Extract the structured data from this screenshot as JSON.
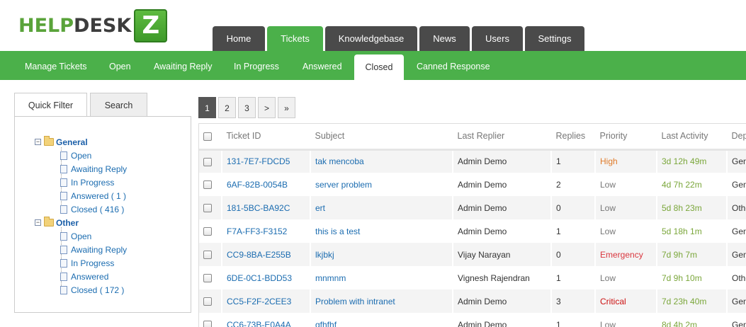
{
  "logo": {
    "part1": "HELP",
    "part2": "DESK",
    "badge": "Z"
  },
  "main_nav": [
    {
      "label": "Home"
    },
    {
      "label": "Tickets"
    },
    {
      "label": "Knowledgebase"
    },
    {
      "label": "News"
    },
    {
      "label": "Users"
    },
    {
      "label": "Settings"
    }
  ],
  "main_nav_active": "Tickets",
  "sub_nav": [
    {
      "label": "Manage Tickets"
    },
    {
      "label": "Open"
    },
    {
      "label": "Awaiting Reply"
    },
    {
      "label": "In Progress"
    },
    {
      "label": "Answered"
    },
    {
      "label": "Closed"
    },
    {
      "label": "Canned Response"
    }
  ],
  "sub_nav_active": "Closed",
  "filter_tabs": [
    {
      "label": "Quick Filter"
    },
    {
      "label": "Search"
    }
  ],
  "tree": {
    "groups": [
      {
        "label": "General",
        "items": [
          {
            "label": "Open"
          },
          {
            "label": "Awaiting Reply"
          },
          {
            "label": "In Progress"
          },
          {
            "label": "Answered ( 1 )"
          },
          {
            "label": "Closed ( 416 )"
          }
        ]
      },
      {
        "label": "Other",
        "items": [
          {
            "label": "Open"
          },
          {
            "label": "Awaiting Reply"
          },
          {
            "label": "In Progress"
          },
          {
            "label": "Answered"
          },
          {
            "label": "Closed ( 172 )"
          }
        ]
      }
    ]
  },
  "pagination": [
    "1",
    "2",
    "3",
    ">",
    "»"
  ],
  "pagination_active": "1",
  "table": {
    "columns": [
      "Ticket ID",
      "Subject",
      "Last Replier",
      "Replies",
      "Priority",
      "Last Activity",
      "Department"
    ],
    "rows": [
      {
        "id": "131-7E7-FDCD5",
        "subject": "tak mencoba",
        "replier": "Admin Demo",
        "replies": "1",
        "priority": "High",
        "activity": "3d 12h 49m",
        "dept": "General"
      },
      {
        "id": "6AF-82B-0054B",
        "subject": "server problem",
        "replier": "Admin Demo",
        "replies": "2",
        "priority": "Low",
        "activity": "4d 7h 22m",
        "dept": "General"
      },
      {
        "id": "181-5BC-BA92C",
        "subject": "ert",
        "replier": "Admin Demo",
        "replies": "0",
        "priority": "Low",
        "activity": "5d 8h 23m",
        "dept": "Other"
      },
      {
        "id": "F7A-FF3-F3152",
        "subject": "this is a test",
        "replier": "Admin Demo",
        "replies": "1",
        "priority": "Low",
        "activity": "5d 18h 1m",
        "dept": "General"
      },
      {
        "id": "CC9-8BA-E255B",
        "subject": "lkjbkj",
        "replier": "Vijay Narayan",
        "replies": "0",
        "priority": "Emergency",
        "activity": "7d 9h 7m",
        "dept": "General"
      },
      {
        "id": "6DE-0C1-BDD53",
        "subject": "mnmnm",
        "replier": "Vignesh Rajendran",
        "replies": "1",
        "priority": "Low",
        "activity": "7d 9h 10m",
        "dept": "Other"
      },
      {
        "id": "CC5-F2F-2CEE3",
        "subject": "Problem with intranet",
        "replier": "Admin Demo",
        "replies": "3",
        "priority": "Critical",
        "activity": "7d 23h 40m",
        "dept": "General"
      },
      {
        "id": "CC6-73B-E0A4A",
        "subject": "gfhfhf",
        "replier": "Admin Demo",
        "replies": "1",
        "priority": "Low",
        "activity": "8d 4h 2m",
        "dept": "General"
      }
    ]
  },
  "colors": {
    "brand_green": "#4bb04a",
    "nav_dark": "#4a4a4a",
    "link_blue": "#1b6cb0",
    "priority_high": "#e07b2a",
    "priority_emergency": "#d9363e",
    "priority_critical": "#cc1111",
    "activity_green": "#7aa63a"
  }
}
